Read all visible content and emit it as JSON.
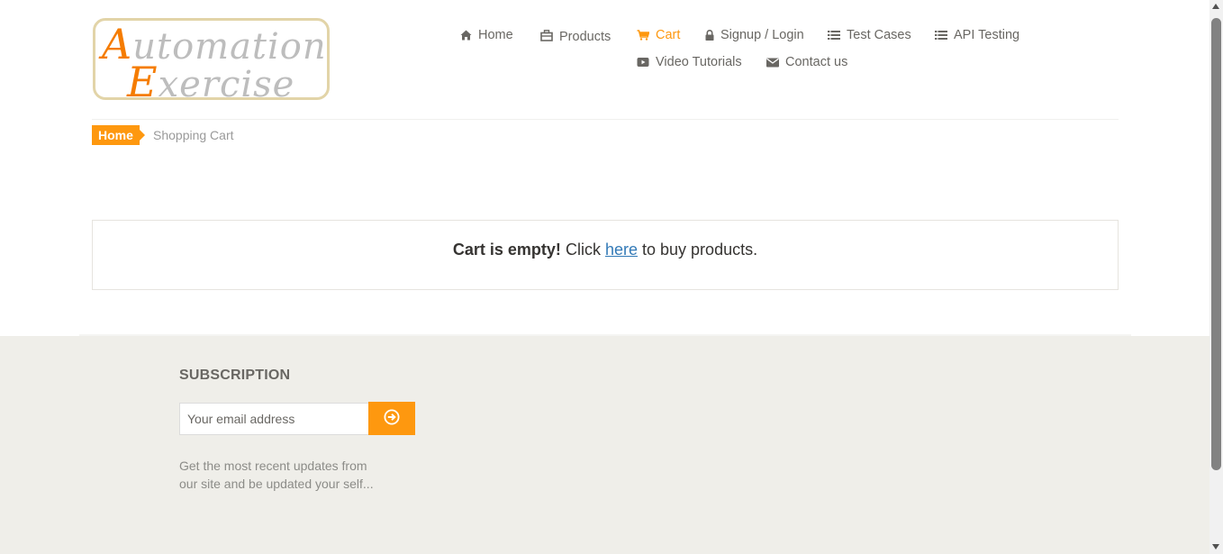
{
  "logo": {
    "line1_cap": "A",
    "line1_rest": "utomation",
    "line2_cap": "E",
    "line2_rest": "xercise"
  },
  "nav": {
    "items": [
      {
        "label": "Home",
        "icon": "home-icon"
      },
      {
        "label": "Products",
        "icon": "products-icon"
      },
      {
        "label": "Cart",
        "icon": "cart-icon",
        "active": true
      },
      {
        "label": "Signup / Login",
        "icon": "lock-icon"
      },
      {
        "label": "Test Cases",
        "icon": "list-icon"
      },
      {
        "label": "API Testing",
        "icon": "list-icon"
      },
      {
        "label": "Video Tutorials",
        "icon": "youtube-play-icon"
      },
      {
        "label": "Contact us",
        "icon": "envelope-icon"
      }
    ]
  },
  "breadcrumb": {
    "home": "Home",
    "current": "Shopping Cart"
  },
  "cart": {
    "empty_bold": "Cart is empty!",
    "click_text": "Click",
    "link_text": "here",
    "after_link": "to buy products."
  },
  "footer": {
    "subscription_title": "SUBSCRIPTION",
    "email_placeholder": "Your email address",
    "description": "Get the most recent updates from our site and be updated your self..."
  },
  "colors": {
    "accent": "#FE980F",
    "text": "#696763",
    "footer_bg": "#EFEEE9",
    "link": "#337AB7"
  }
}
